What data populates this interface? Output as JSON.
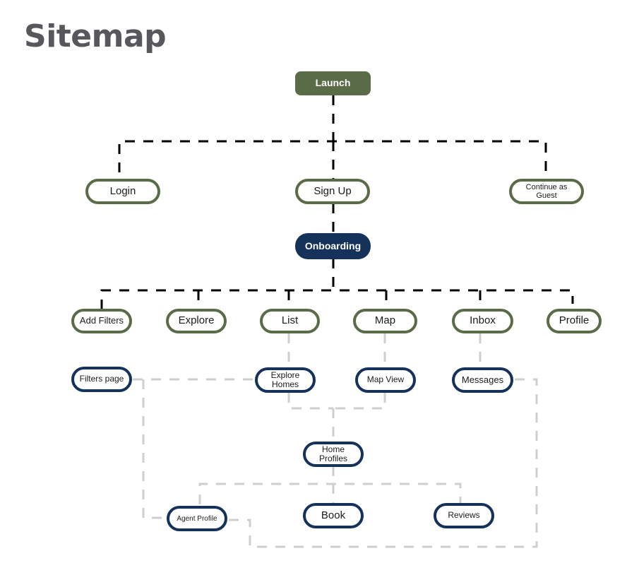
{
  "title": "Sitemap",
  "colors": {
    "title": "#58575c",
    "green": "#5a6b48",
    "navy": "#15335a",
    "primary_link": "#000000",
    "secondary_link": "#cfcfcf"
  },
  "nodes": {
    "launch": "Launch",
    "login": "Login",
    "sign_up": "Sign Up",
    "continue_guest": "Continue as Guest",
    "onboarding": "Onboarding",
    "add_filters": "Add Filters",
    "explore": "Explore",
    "list": "List",
    "map": "Map",
    "inbox": "Inbox",
    "profile": "Profile",
    "filters_page": "Filters page",
    "explore_homes": "Explore Homes",
    "map_view": "Map View",
    "messages": "Messages",
    "home_profiles": "Home Profiles",
    "agent_profile": "Agent Profile",
    "book": "Book",
    "reviews": "Reviews"
  },
  "edges": [
    [
      "launch",
      "login"
    ],
    [
      "launch",
      "sign_up"
    ],
    [
      "launch",
      "continue_guest"
    ],
    [
      "sign_up",
      "onboarding"
    ],
    [
      "onboarding",
      "add_filters"
    ],
    [
      "onboarding",
      "explore"
    ],
    [
      "onboarding",
      "list"
    ],
    [
      "onboarding",
      "map"
    ],
    [
      "onboarding",
      "inbox"
    ],
    [
      "onboarding",
      "profile"
    ],
    [
      "list",
      "explore_homes"
    ],
    [
      "map",
      "map_view"
    ],
    [
      "inbox",
      "messages"
    ],
    [
      "explore_homes",
      "home_profiles"
    ],
    [
      "map_view",
      "home_profiles"
    ],
    [
      "home_profiles",
      "agent_profile"
    ],
    [
      "home_profiles",
      "book"
    ],
    [
      "home_profiles",
      "reviews"
    ],
    [
      "filters_page",
      "explore_homes"
    ],
    [
      "filters_page",
      "agent_profile"
    ],
    [
      "messages",
      "agent_profile"
    ]
  ]
}
